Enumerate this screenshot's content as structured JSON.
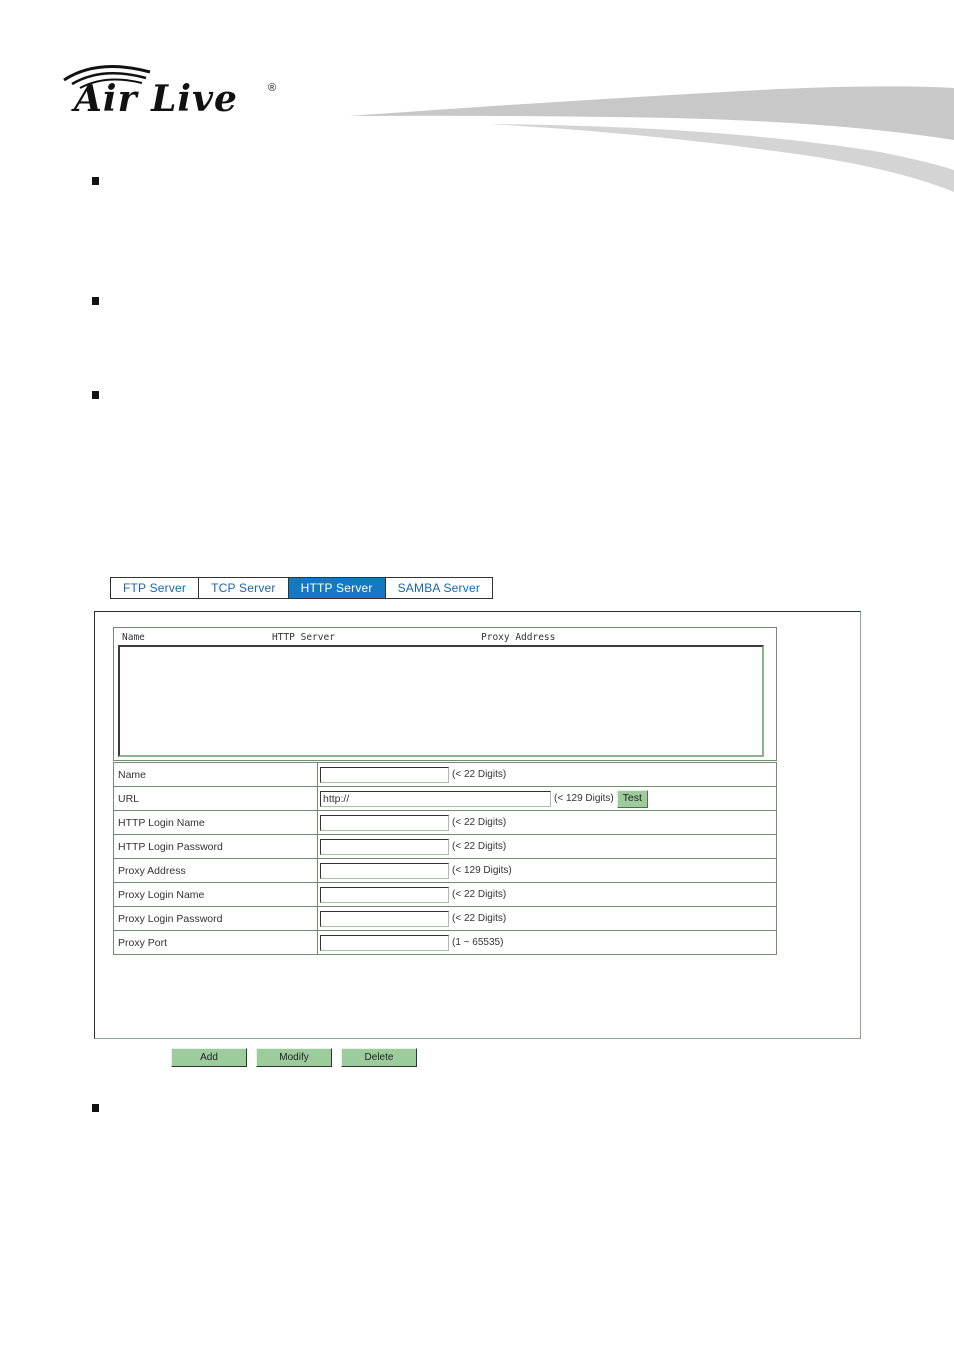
{
  "brand": {
    "logo_text": "Air Live",
    "registered_mark": "®"
  },
  "tabs": [
    {
      "label": "FTP Server",
      "active": false
    },
    {
      "label": "TCP Server",
      "active": false
    },
    {
      "label": "HTTP Server",
      "active": true
    },
    {
      "label": "SAMBA Server",
      "active": false
    }
  ],
  "list": {
    "columns": [
      "Name",
      "HTTP Server",
      "Proxy Address"
    ],
    "items": []
  },
  "form": {
    "rows": [
      {
        "label": "Name",
        "value": "",
        "hint": "(< 22 Digits)"
      },
      {
        "label": "URL",
        "value": "http://",
        "hint": "(< 129 Digits)",
        "button": "Test"
      },
      {
        "label": "HTTP Login Name",
        "value": "",
        "hint": "(< 22 Digits)"
      },
      {
        "label": "HTTP Login Password",
        "value": "",
        "hint": "(< 22 Digits)"
      },
      {
        "label": "Proxy Address",
        "value": "",
        "hint": "(< 129 Digits)"
      },
      {
        "label": "Proxy Login Name",
        "value": "",
        "hint": "(< 22 Digits)"
      },
      {
        "label": "Proxy Login Password",
        "value": "",
        "hint": "(< 22 Digits)"
      },
      {
        "label": "Proxy Port",
        "value": "",
        "hint": "(1 ~ 65535)"
      }
    ]
  },
  "actions": {
    "add": "Add",
    "modify": "Modify",
    "delete": "Delete"
  },
  "colors": {
    "active_tab": "#1479c2",
    "tab_text": "#1a63b0",
    "button_bg": "#9ccc9c",
    "border_green": "#6f8f6f"
  }
}
